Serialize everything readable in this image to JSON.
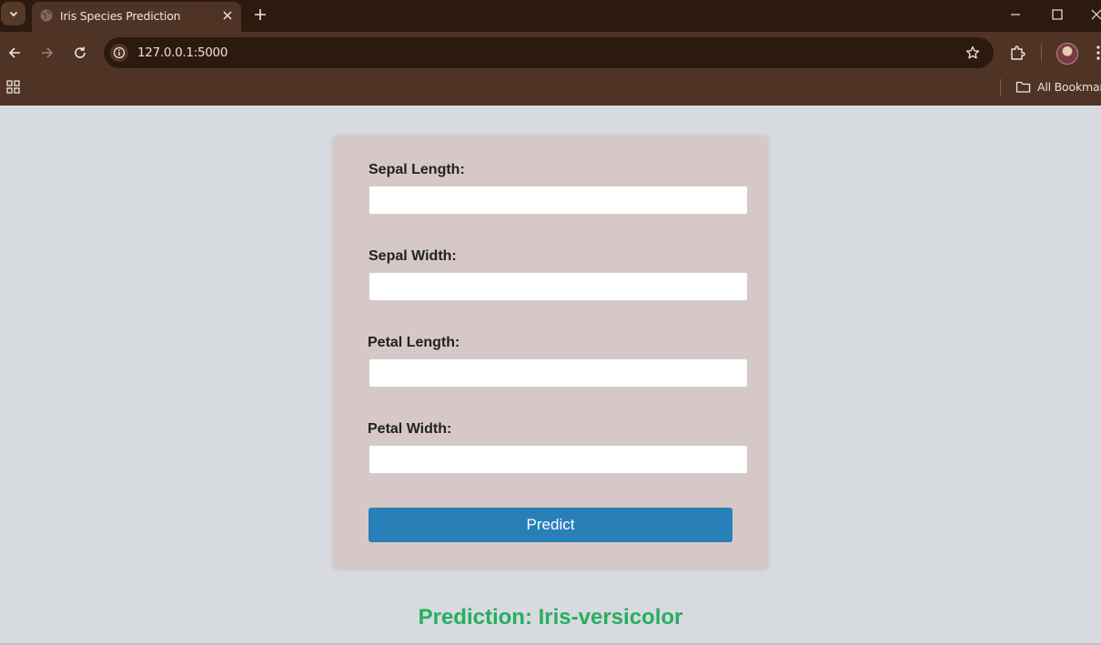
{
  "browser": {
    "tab_title": "Iris Species Prediction",
    "url": "127.0.0.1:5000",
    "bookmarks_label": "All Bookmarks",
    "colors": {
      "titlebar": "#2d1a0e",
      "toolbar": "#4f3425"
    },
    "icons": [
      "tab-list-icon",
      "globe-icon",
      "close-icon",
      "new-tab-icon",
      "minimize-icon",
      "maximize-icon",
      "window-close-icon",
      "back-icon",
      "forward-icon",
      "reload-icon",
      "site-info-icon",
      "star-icon",
      "extensions-icon",
      "avatar",
      "menu-icon",
      "apps-icon",
      "folder-icon"
    ]
  },
  "form": {
    "fields": [
      {
        "label": "Sepal Length:",
        "value": "",
        "placeholder": ""
      },
      {
        "label": "Sepal Width:",
        "value": "",
        "placeholder": ""
      },
      {
        "label": "Petal Length:",
        "value": "",
        "placeholder": ""
      },
      {
        "label": "Petal Width:",
        "value": "",
        "placeholder": ""
      }
    ],
    "submit_label": "Predict",
    "colors": {
      "card": "#d6c8c7",
      "button": "#2980b9"
    }
  },
  "result": {
    "text": "Prediction: Iris-versicolor",
    "color": "#27ae60"
  }
}
